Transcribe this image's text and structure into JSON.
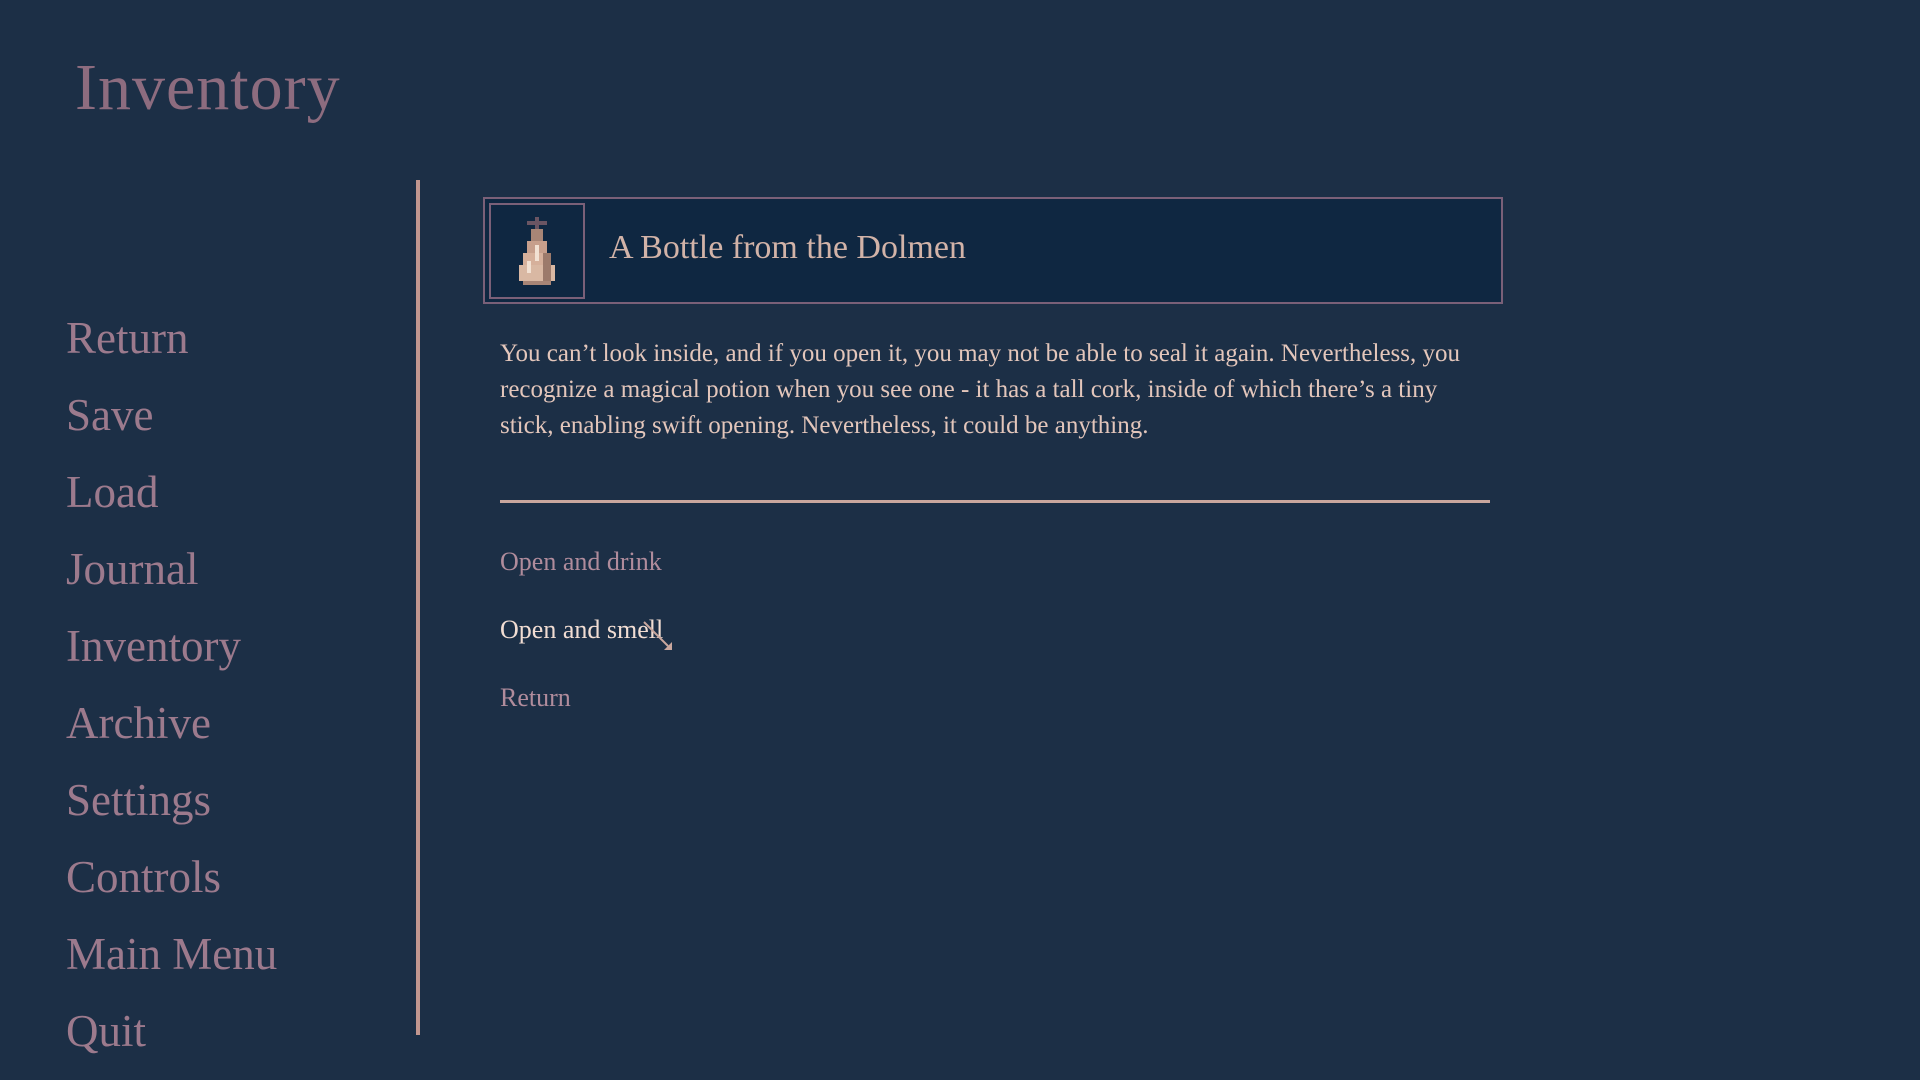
{
  "header": {
    "title": "Inventory"
  },
  "menu": {
    "items": [
      {
        "label": "Return"
      },
      {
        "label": "Save"
      },
      {
        "label": "Load"
      },
      {
        "label": "Journal"
      },
      {
        "label": "Inventory"
      },
      {
        "label": "Archive"
      },
      {
        "label": "Settings"
      },
      {
        "label": "Controls"
      },
      {
        "label": "Main Menu"
      },
      {
        "label": "Quit"
      }
    ]
  },
  "item": {
    "name": "A Bottle from the Dolmen",
    "icon": "potion-bottle-icon",
    "description": "You can’t look inside, and if you open it, you may not be able to seal it again. Nevertheless, you recognize a magical potion when you see one - it has a tall cork, inside of which there’s a tiny stick, enabling swift opening. Nevertheless, it could be anything."
  },
  "actions": [
    {
      "label": "Open and drink",
      "state": "normal"
    },
    {
      "label": "Open and smell",
      "state": "hovered"
    },
    {
      "label": "Return",
      "state": "normal"
    }
  ],
  "colors": {
    "background": "#1c2f46",
    "panel": "#0f2741",
    "menu_text": "#9c7a8d",
    "accent_line": "#c1968f",
    "body_text": "#e3c6bb",
    "hover_text": "#f1ddd3"
  }
}
